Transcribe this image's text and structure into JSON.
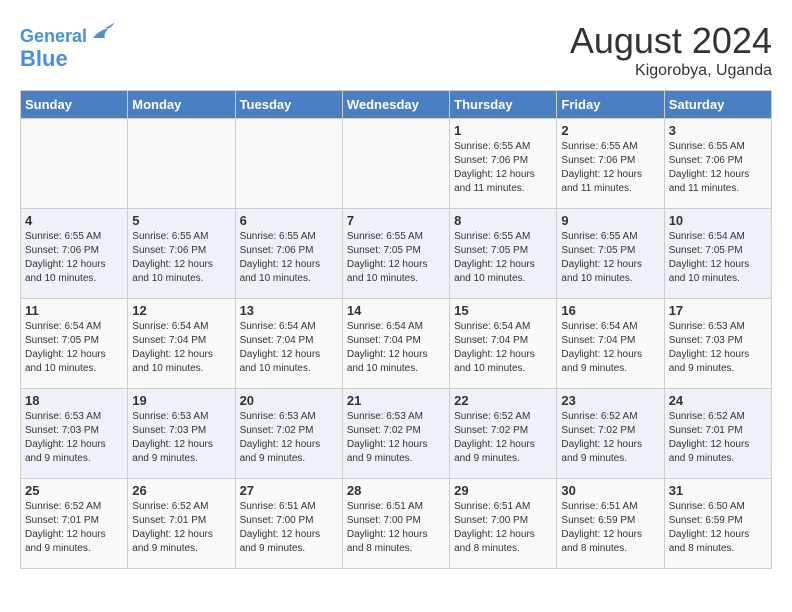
{
  "header": {
    "logo_line1": "General",
    "logo_line2": "Blue",
    "month_title": "August 2024",
    "location": "Kigorobya, Uganda"
  },
  "weekdays": [
    "Sunday",
    "Monday",
    "Tuesday",
    "Wednesday",
    "Thursday",
    "Friday",
    "Saturday"
  ],
  "weeks": [
    [
      {
        "day": "",
        "info": ""
      },
      {
        "day": "",
        "info": ""
      },
      {
        "day": "",
        "info": ""
      },
      {
        "day": "",
        "info": ""
      },
      {
        "day": "1",
        "info": "Sunrise: 6:55 AM\nSunset: 7:06 PM\nDaylight: 12 hours and 11 minutes."
      },
      {
        "day": "2",
        "info": "Sunrise: 6:55 AM\nSunset: 7:06 PM\nDaylight: 12 hours and 11 minutes."
      },
      {
        "day": "3",
        "info": "Sunrise: 6:55 AM\nSunset: 7:06 PM\nDaylight: 12 hours and 11 minutes."
      }
    ],
    [
      {
        "day": "4",
        "info": "Sunrise: 6:55 AM\nSunset: 7:06 PM\nDaylight: 12 hours and 10 minutes."
      },
      {
        "day": "5",
        "info": "Sunrise: 6:55 AM\nSunset: 7:06 PM\nDaylight: 12 hours and 10 minutes."
      },
      {
        "day": "6",
        "info": "Sunrise: 6:55 AM\nSunset: 7:06 PM\nDaylight: 12 hours and 10 minutes."
      },
      {
        "day": "7",
        "info": "Sunrise: 6:55 AM\nSunset: 7:05 PM\nDaylight: 12 hours and 10 minutes."
      },
      {
        "day": "8",
        "info": "Sunrise: 6:55 AM\nSunset: 7:05 PM\nDaylight: 12 hours and 10 minutes."
      },
      {
        "day": "9",
        "info": "Sunrise: 6:55 AM\nSunset: 7:05 PM\nDaylight: 12 hours and 10 minutes."
      },
      {
        "day": "10",
        "info": "Sunrise: 6:54 AM\nSunset: 7:05 PM\nDaylight: 12 hours and 10 minutes."
      }
    ],
    [
      {
        "day": "11",
        "info": "Sunrise: 6:54 AM\nSunset: 7:05 PM\nDaylight: 12 hours and 10 minutes."
      },
      {
        "day": "12",
        "info": "Sunrise: 6:54 AM\nSunset: 7:04 PM\nDaylight: 12 hours and 10 minutes."
      },
      {
        "day": "13",
        "info": "Sunrise: 6:54 AM\nSunset: 7:04 PM\nDaylight: 12 hours and 10 minutes."
      },
      {
        "day": "14",
        "info": "Sunrise: 6:54 AM\nSunset: 7:04 PM\nDaylight: 12 hours and 10 minutes."
      },
      {
        "day": "15",
        "info": "Sunrise: 6:54 AM\nSunset: 7:04 PM\nDaylight: 12 hours and 10 minutes."
      },
      {
        "day": "16",
        "info": "Sunrise: 6:54 AM\nSunset: 7:04 PM\nDaylight: 12 hours and 9 minutes."
      },
      {
        "day": "17",
        "info": "Sunrise: 6:53 AM\nSunset: 7:03 PM\nDaylight: 12 hours and 9 minutes."
      }
    ],
    [
      {
        "day": "18",
        "info": "Sunrise: 6:53 AM\nSunset: 7:03 PM\nDaylight: 12 hours and 9 minutes."
      },
      {
        "day": "19",
        "info": "Sunrise: 6:53 AM\nSunset: 7:03 PM\nDaylight: 12 hours and 9 minutes."
      },
      {
        "day": "20",
        "info": "Sunrise: 6:53 AM\nSunset: 7:02 PM\nDaylight: 12 hours and 9 minutes."
      },
      {
        "day": "21",
        "info": "Sunrise: 6:53 AM\nSunset: 7:02 PM\nDaylight: 12 hours and 9 minutes."
      },
      {
        "day": "22",
        "info": "Sunrise: 6:52 AM\nSunset: 7:02 PM\nDaylight: 12 hours and 9 minutes."
      },
      {
        "day": "23",
        "info": "Sunrise: 6:52 AM\nSunset: 7:02 PM\nDaylight: 12 hours and 9 minutes."
      },
      {
        "day": "24",
        "info": "Sunrise: 6:52 AM\nSunset: 7:01 PM\nDaylight: 12 hours and 9 minutes."
      }
    ],
    [
      {
        "day": "25",
        "info": "Sunrise: 6:52 AM\nSunset: 7:01 PM\nDaylight: 12 hours and 9 minutes."
      },
      {
        "day": "26",
        "info": "Sunrise: 6:52 AM\nSunset: 7:01 PM\nDaylight: 12 hours and 9 minutes."
      },
      {
        "day": "27",
        "info": "Sunrise: 6:51 AM\nSunset: 7:00 PM\nDaylight: 12 hours and 9 minutes."
      },
      {
        "day": "28",
        "info": "Sunrise: 6:51 AM\nSunset: 7:00 PM\nDaylight: 12 hours and 8 minutes."
      },
      {
        "day": "29",
        "info": "Sunrise: 6:51 AM\nSunset: 7:00 PM\nDaylight: 12 hours and 8 minutes."
      },
      {
        "day": "30",
        "info": "Sunrise: 6:51 AM\nSunset: 6:59 PM\nDaylight: 12 hours and 8 minutes."
      },
      {
        "day": "31",
        "info": "Sunrise: 6:50 AM\nSunset: 6:59 PM\nDaylight: 12 hours and 8 minutes."
      }
    ]
  ]
}
